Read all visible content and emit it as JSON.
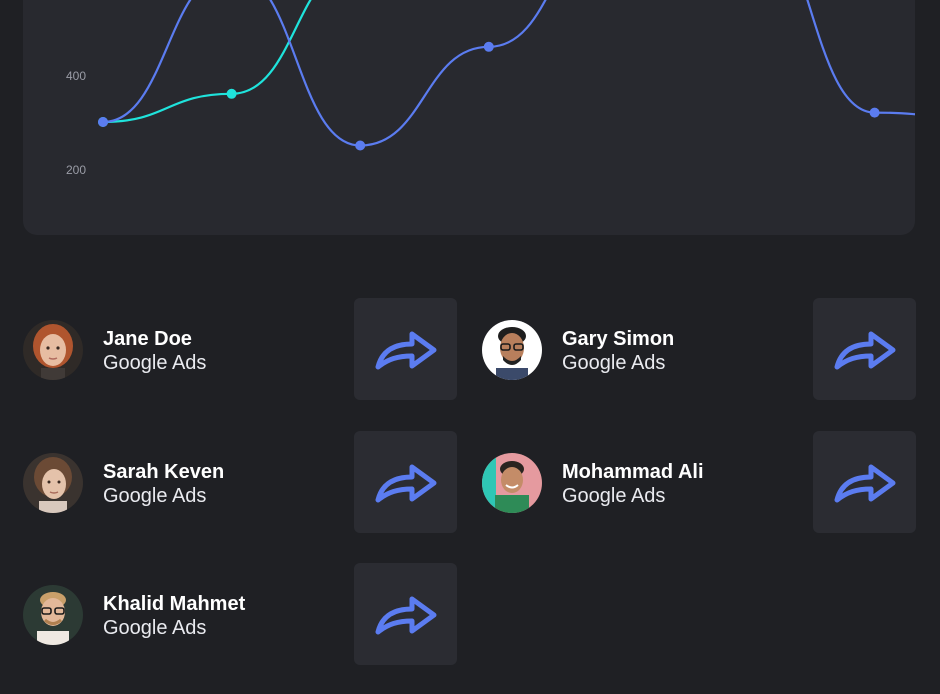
{
  "chart_data": {
    "type": "line",
    "y_tick_labels": [
      "400",
      "200"
    ],
    "x": [
      1,
      2,
      3,
      4,
      5,
      6,
      7,
      8
    ],
    "series": [
      {
        "color": "#5b7cf0",
        "values": [
          300,
          620,
          250,
          460,
          720,
          760,
          320,
          300
        ]
      },
      {
        "color": "#1fe3dc",
        "values": [
          300,
          360,
          640,
          700,
          730,
          740,
          630,
          300
        ]
      }
    ]
  },
  "people": [
    {
      "name": "Jane Doe",
      "source": "Google Ads",
      "avatar_icon": "woman-redhead-avatar"
    },
    {
      "name": "Gary Simon",
      "source": "Google Ads",
      "avatar_icon": "man-glasses-avatar"
    },
    {
      "name": "Sarah Keven",
      "source": "Google Ads",
      "avatar_icon": "woman-portrait-avatar"
    },
    {
      "name": "Mohammad Ali",
      "source": "Google Ads",
      "avatar_icon": "man-smiling-avatar"
    },
    {
      "name": "Khalid Mahmet",
      "source": "Google Ads",
      "avatar_icon": "man-blond-glasses-avatar"
    }
  ],
  "action_icon": "share-arrow-icon",
  "colors": {
    "accent_blue": "#5b7cf0",
    "accent_cyan": "#1fe3dc",
    "card_bg": "#28292f",
    "page_bg": "#1f2024"
  }
}
